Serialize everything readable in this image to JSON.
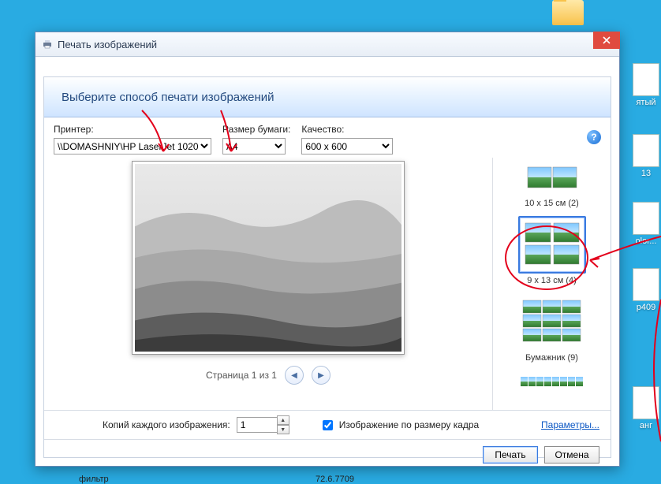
{
  "desktop": {
    "icons": [
      {
        "label": ""
      },
      {
        "label": "ятый"
      },
      {
        "label": "olor..."
      },
      {
        "label": "13"
      },
      {
        "label": "p409"
      },
      {
        "label": "анг"
      }
    ]
  },
  "dialog": {
    "title": "Печать изображений",
    "banner": "Выберите способ печати изображений",
    "printer_label": "Принтер:",
    "printer_value": "\\\\DOMASHNIY\\HP LaserJet 1020",
    "paper_label": "Размер бумаги:",
    "paper_value": "A4",
    "quality_label": "Качество:",
    "quality_value": "600 x 600",
    "pager_text": "Страница 1 из 1",
    "layouts": [
      {
        "caption": "10 x 15 см (2)"
      },
      {
        "caption": "9 x 13 см (4)"
      },
      {
        "caption": "Бумажник (9)"
      },
      {
        "caption": ""
      }
    ],
    "copies_label": "Копий каждого изображения:",
    "copies_value": "1",
    "fit_label": "Изображение по размеру кадра",
    "options_link": "Параметры...",
    "print_btn": "Печать",
    "cancel_btn": "Отмена"
  },
  "bg": {
    "t1": "фильтр",
    "t2": "72.6.7709"
  }
}
